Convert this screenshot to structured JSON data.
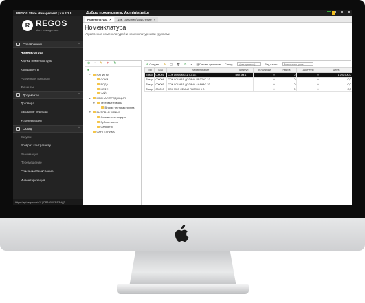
{
  "app": {
    "title": "REGOS Store Management  |  v.0.2.3.8",
    "welcome": "Добро пожаловать, Administrator"
  },
  "logo": {
    "name": "REGOS",
    "tagline": "store management"
  },
  "sidebar": {
    "sections": [
      {
        "label": "Справочники",
        "items": [
          {
            "label": "Номенклатура",
            "active": true
          },
          {
            "label": "Хар-ки номенклатуры"
          },
          {
            "label": "Контрагенты"
          },
          {
            "label": "Розничная торговля",
            "dim": true
          },
          {
            "label": "Финансы",
            "dim": true
          }
        ]
      },
      {
        "label": "Документы",
        "items": [
          {
            "label": "Договора"
          },
          {
            "label": "Закрытие периода"
          },
          {
            "label": "Установка цен"
          }
        ]
      },
      {
        "label": "Склад",
        "items": [
          {
            "label": "Закупки",
            "dim": true
          },
          {
            "label": "Возврат контрагенту"
          },
          {
            "label": "Реализация",
            "dim": true
          },
          {
            "label": "Перемещение",
            "dim": true
          },
          {
            "label": "Списание/Зачисление"
          },
          {
            "label": "Инвентаризация"
          }
        ]
      }
    ],
    "url": "https://api.regos.uz/v1/ | DB100003-ЕЗНД3"
  },
  "tabs": [
    {
      "label": "Номенклатура",
      "active": true
    },
    {
      "label": "Док. списание/зачисление"
    }
  ],
  "page": {
    "title": "Номенклатура",
    "subtitle": "Управление номенклатурой и номенклатурными группами"
  },
  "tree": [
    {
      "label": "НАПИТКИ",
      "level": 0,
      "toggle": "▾"
    },
    {
      "label": "СОКИ",
      "level": 1
    },
    {
      "label": "ВОДА",
      "level": 1
    },
    {
      "label": "КОФЕ",
      "level": 1
    },
    {
      "label": "ЧАЙ",
      "level": 1
    },
    {
      "label": "МЯСНАЯ ПРОДУКЦИЯ",
      "level": 0,
      "toggle": "▸"
    },
    {
      "label": "Тестовые товары",
      "level": 1,
      "toggle": "▾"
    },
    {
      "label": "Вторая тестовая группа",
      "level": 2
    },
    {
      "label": "БЫТОВАЯ ХИМИЯ",
      "level": 0,
      "toggle": "▾"
    },
    {
      "label": "Освежители воздуха",
      "level": 1
    },
    {
      "label": "Зубная паста",
      "level": 1
    },
    {
      "label": "Салфетки",
      "level": 1
    },
    {
      "label": "САНТЕХНИКА",
      "level": 0
    }
  ],
  "grid_toolbar": {
    "create": "Создать",
    "print": "Печать ценников",
    "warehouse_label": "Склад:",
    "warehouse_value": "(нет данных)",
    "price_label": "Вид цены:",
    "price_value": "Розничная цена"
  },
  "grid": {
    "columns": [
      "Тип",
      "Код",
      "Наименование",
      "Артикул",
      "В наличии",
      "Резерв",
      "Доступно",
      "Цена"
    ],
    "rows": [
      {
        "type": "Товар",
        "code": "000001",
        "name": "СОК DENA МОХИТО 1Л.",
        "article": "5юК Мд 1",
        "stock": "0",
        "reserve": "0",
        "available": "0",
        "price": "1 292 500,0",
        "selected": true
      },
      {
        "type": "Товар",
        "code": "000004",
        "name": "СОК СОЧНАЯ ДОЛИНА ЯБЛОКО 1Л",
        "article": "",
        "stock": "0",
        "reserve": "0",
        "available": "0",
        "price": "0,0"
      },
      {
        "type": "Товар",
        "code": "000003",
        "name": "СОК СОЧНАЯ ДОЛИНА АНАНАС 1Л",
        "article": "",
        "stock": "0",
        "reserve": "0",
        "available": "0",
        "price": "0,0"
      },
      {
        "type": "Товар",
        "code": "000010",
        "name": "СОК МОЯ СЕМЬЯ ЯБЛОКО 1 Л.",
        "article": "",
        "stock": "0",
        "reserve": "0",
        "available": "0",
        "price": "0,0"
      }
    ]
  },
  "colors": {
    "sidebar": "#232323",
    "accent_green": "#2a9a3a",
    "folder": "#f3c54a"
  }
}
